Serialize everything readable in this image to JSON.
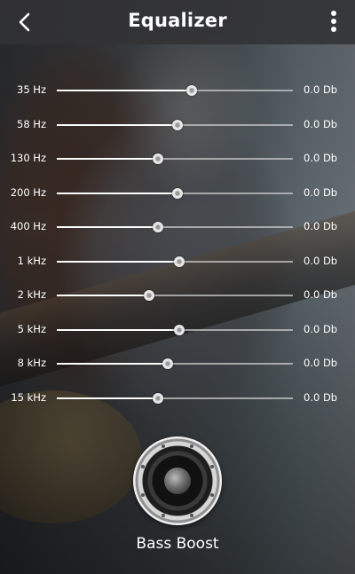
{
  "header": {
    "title": "Equalizer",
    "back_icon": "chevron-left-icon",
    "menu_icon": "more-vert-icon"
  },
  "bands": [
    {
      "freq": "35 Hz",
      "value": "0.0 Db",
      "level": 0.57
    },
    {
      "freq": "58 Hz",
      "value": "0.0 Db",
      "level": 0.51
    },
    {
      "freq": "130 Hz",
      "value": "0.0 Db",
      "level": 0.43
    },
    {
      "freq": "200 Hz",
      "value": "0.0 Db",
      "level": 0.51
    },
    {
      "freq": "400 Hz",
      "value": "0.0 Db",
      "level": 0.43
    },
    {
      "freq": "1 kHz",
      "value": "0.0 Db",
      "level": 0.52
    },
    {
      "freq": "2 kHz",
      "value": "0.0 Db",
      "level": 0.39
    },
    {
      "freq": "5 kHz",
      "value": "0.0 Db",
      "level": 0.52
    },
    {
      "freq": "8 kHz",
      "value": "0.0 Db",
      "level": 0.47
    },
    {
      "freq": "15 kHz",
      "value": "0.0 Db",
      "level": 0.43
    }
  ],
  "bass_boost": {
    "label": "Bass Boost",
    "icon": "speaker-icon"
  }
}
